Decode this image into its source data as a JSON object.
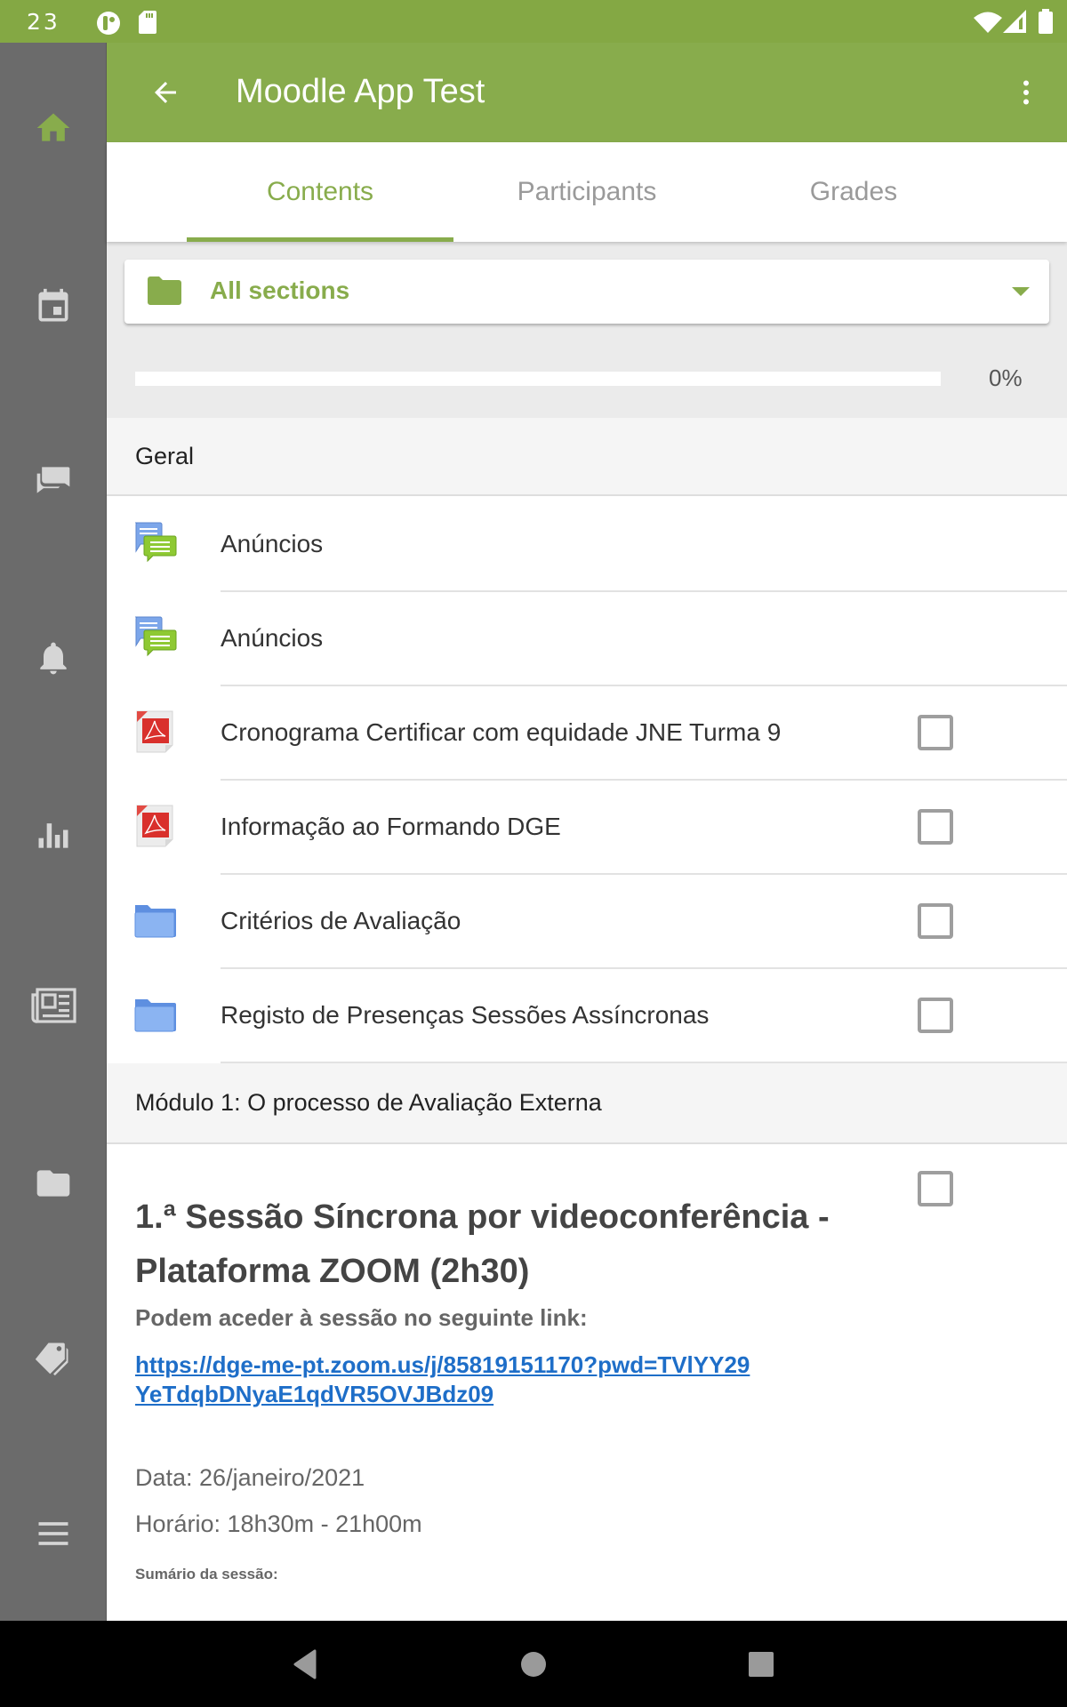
{
  "status_bar": {
    "time": "23",
    "icons": [
      "app-notification-icon",
      "sd-card-icon",
      "wifi-icon",
      "cellular-signal-icon",
      "battery-icon"
    ]
  },
  "colors": {
    "brand": "#88ac4c",
    "status_bar": "#84a844",
    "rail": "#6b6b6b",
    "link": "#1e6ec8"
  },
  "toolbar": {
    "title": "Moodle App Test",
    "back_icon": "arrow-left-icon",
    "more_icon": "more-vert-icon"
  },
  "side_rail": {
    "items": [
      {
        "name": "home",
        "icon": "home-icon",
        "active": true
      },
      {
        "name": "calendar",
        "icon": "calendar-icon",
        "active": false
      },
      {
        "name": "messages",
        "icon": "chat-icon",
        "active": false
      },
      {
        "name": "notifications",
        "icon": "bell-icon",
        "active": false
      },
      {
        "name": "grades",
        "icon": "bar-chart-icon",
        "active": false
      },
      {
        "name": "news",
        "icon": "newspaper-icon",
        "active": false
      },
      {
        "name": "files",
        "icon": "folder-icon",
        "active": false
      },
      {
        "name": "tags",
        "icon": "tags-icon",
        "active": false
      },
      {
        "name": "more",
        "icon": "menu-icon",
        "active": false
      }
    ]
  },
  "tabs": [
    {
      "label": "Contents",
      "active": true
    },
    {
      "label": "Participants",
      "active": false
    },
    {
      "label": "Grades",
      "active": false
    }
  ],
  "section_selector": {
    "icon": "folder-icon",
    "selected": "All sections"
  },
  "progress": {
    "percent": 0,
    "label": "0%"
  },
  "sections": [
    {
      "title": "Geral",
      "modules": [
        {
          "name": "Anúncios",
          "type": "forum",
          "icon": "forum-icon",
          "has_checkbox": false
        },
        {
          "name": "Anúncios",
          "type": "forum",
          "icon": "forum-icon",
          "has_checkbox": false
        },
        {
          "name": "Cronograma Certificar com equidade JNE Turma 9",
          "type": "pdf",
          "icon": "pdf-icon",
          "has_checkbox": true,
          "checked": false
        },
        {
          "name": "Informação ao Formando DGE",
          "type": "pdf",
          "icon": "pdf-icon",
          "has_checkbox": true,
          "checked": false
        },
        {
          "name": "Critérios de Avaliação",
          "type": "folder",
          "icon": "folder-icon",
          "has_checkbox": true,
          "checked": false
        },
        {
          "name": "Registo de Presenças Sessões Assíncronas",
          "type": "folder",
          "icon": "folder-icon",
          "has_checkbox": true,
          "checked": false
        }
      ]
    },
    {
      "title": "Módulo 1: O processo de Avaliação Externa",
      "label_module": {
        "heading": "1.ª Sessão Síncrona por videoconferência - Plataforma ZOOM (2h30)",
        "subtitle": "Podem aceder à sessão no seguinte link:",
        "link": "https://dge-me-pt.zoom.us/j/85819151170?pwd=TVlYY29YeTdqbDNyaE1qdVR5OVJBdz09",
        "date": "Data: 26/janeiro/2021",
        "time": "Horário: 18h30m - 21h00m",
        "summary_label": "Sumário da sessão:",
        "checked": false
      }
    }
  ],
  "nav_bar": {
    "buttons": [
      "back-icon",
      "home-icon",
      "recents-icon"
    ]
  }
}
